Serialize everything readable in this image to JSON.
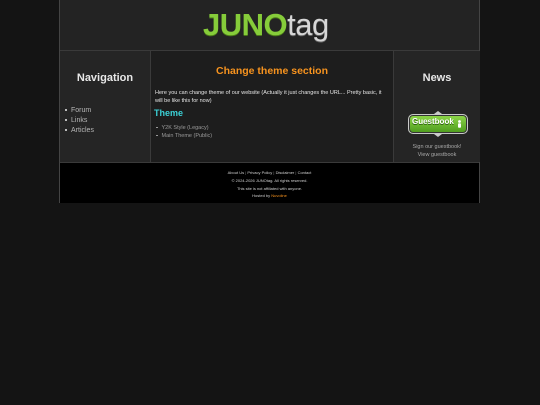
{
  "logo": {
    "part1": "JUNO",
    "part2": "tag"
  },
  "nav": {
    "title": "Navigation",
    "items": [
      {
        "label": "Forum"
      },
      {
        "label": "Links"
      },
      {
        "label": "Articles"
      }
    ]
  },
  "content": {
    "title": "Change theme section",
    "intro": "Here you can change theme of our website (Actually it just changes the URL... Pretty basic, it will be like this for now)",
    "theme_heading": "Theme",
    "themes": [
      {
        "label": "Y2K Style (Legacy)"
      },
      {
        "label": "Main Theme (Public)"
      }
    ]
  },
  "news": {
    "title": "News",
    "guestbook_button": "Guestbook",
    "sign_text": "Sign our guestbook!",
    "view_text": "View guestbook"
  },
  "footer": {
    "links": [
      "About Us",
      "Privacy Policy",
      "Disclaimer",
      "Contact"
    ],
    "separator": "|",
    "copyright": "© 2024-2026 JUNOtag. All rights reserved.",
    "affiliation": "This site is not affiliated with anyone.",
    "hosted_prefix": "Hosted by",
    "host": "Nuvoline"
  },
  "colors": {
    "logo_green": "#86cc3a",
    "section_title": "#f7931e",
    "theme_heading": "#3bd1d6",
    "background": "#141414"
  }
}
